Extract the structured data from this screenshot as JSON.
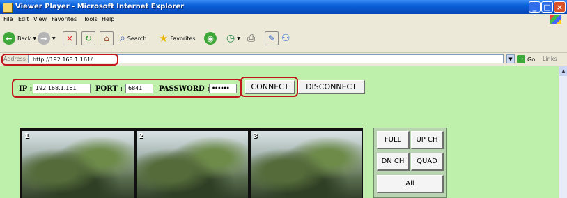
{
  "window": {
    "title": "Viewer Player - Microsoft Internet Explorer"
  },
  "menu": [
    "File",
    "Edit",
    "View",
    "Favorites",
    "Tools",
    "Help"
  ],
  "toolbar": {
    "back": "Back",
    "search": "Search",
    "favorites": "Favorites"
  },
  "address": {
    "label": "Address",
    "url": "http://192.168.1.161/",
    "go": "Go",
    "links": "Links"
  },
  "form": {
    "ip_label": "IP :",
    "ip_value": "192.168.1.161",
    "port_label": "PORT :",
    "port_value": "6841",
    "password_label": "PASSWORD :",
    "password_value": "••••••",
    "connect": "CONNECT",
    "disconnect": "DISCONNECT"
  },
  "channels": [
    "1",
    "2",
    "3"
  ],
  "controls": {
    "full": "FULL",
    "up_ch": "UP CH",
    "dn_ch": "DN CH",
    "quad": "QUAD",
    "all": "All"
  },
  "colors": {
    "page_background": "#bff0ab",
    "annotation_red": "#c0161c",
    "titlebar_blue": "#0a5fd8"
  }
}
